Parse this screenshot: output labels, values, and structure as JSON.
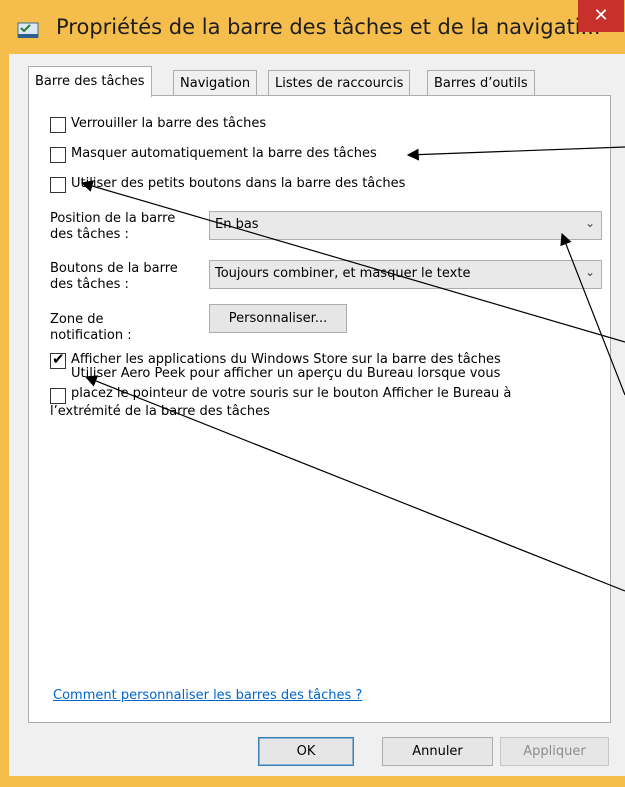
{
  "window": {
    "title": "Propriétés de la barre des tâches et de la navigati...",
    "close_glyph": "✕",
    "app_icon": "taskbar-properties-icon"
  },
  "tabs": [
    {
      "label": "Barre des tâches",
      "active": true
    },
    {
      "label": "Navigation",
      "active": false
    },
    {
      "label": "Listes de raccourcis",
      "active": false
    },
    {
      "label": "Barres d’outils",
      "active": false
    }
  ],
  "options": {
    "lock_taskbar": {
      "label": "Verrouiller la barre des tâches",
      "checked": false
    },
    "auto_hide": {
      "label": "Masquer automatiquement la barre des tâches",
      "checked": false
    },
    "small_buttons": {
      "label": "Utiliser des petits boutons dans la barre des tâches",
      "checked": false
    },
    "show_store_apps": {
      "label": "Afficher les applications du Windows Store sur la barre des tâches",
      "checked": true
    },
    "aero_peek": {
      "line1": "Utiliser Aero Peek pour afficher un aperçu du Bureau lorsque vous",
      "line2": "placez le pointeur de votre souris sur le bouton Afficher le Bureau à",
      "line3": "l’extrémité de la barre des tâches",
      "checked": false
    }
  },
  "position": {
    "label1": "Position de la barre",
    "label2": "des tâches :",
    "value": "En bas"
  },
  "buttons_combine": {
    "label1": "Boutons de la barre",
    "label2": "des tâches :",
    "value": "Toujours combiner, et masquer le texte"
  },
  "notification": {
    "label1": "Zone de",
    "label2": "notification :",
    "button": "Personnaliser..."
  },
  "help_link": "Comment personnaliser les barres des tâches ?",
  "footer": {
    "ok": "OK",
    "cancel": "Annuler",
    "apply": "Appliquer"
  },
  "colors": {
    "frame": "#f5bd4b",
    "close": "#c7302b",
    "link": "#0066cc"
  }
}
